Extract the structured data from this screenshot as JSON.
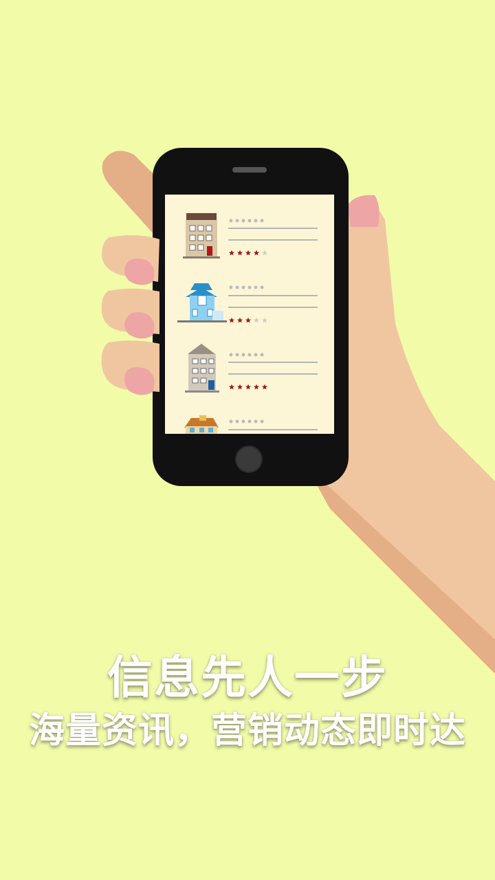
{
  "splash": {
    "headline": "信息先人一步",
    "subheadline": "海量资讯，营销动态即时达"
  },
  "listing_items": [
    {
      "icon": "townhouse-icon",
      "rating": 4,
      "max_rating": 5
    },
    {
      "icon": "blue-house-icon",
      "rating": 3,
      "max_rating": 5
    },
    {
      "icon": "grey-apartment-icon",
      "rating": 5,
      "max_rating": 5
    },
    {
      "icon": "cottage-icon",
      "rating": null,
      "max_rating": 5
    }
  ],
  "colors": {
    "background": "#f1fba8",
    "phone_body": "#111111",
    "screen": "#fdf6d6",
    "skin": "#f0c6a0",
    "skin_shadow": "#e4ae86",
    "star_filled": "#a31515",
    "star_empty": "#cccccc"
  }
}
